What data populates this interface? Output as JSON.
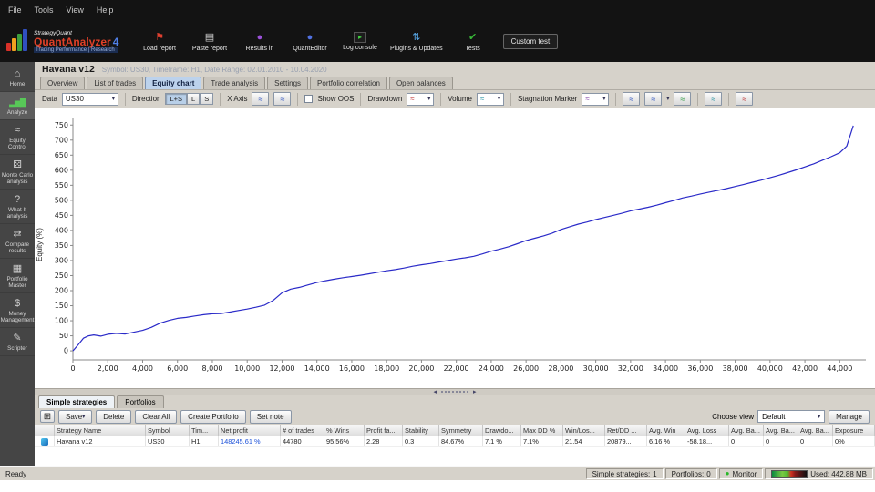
{
  "menu": {
    "items": [
      "File",
      "Tools",
      "View",
      "Help"
    ]
  },
  "brand": {
    "app": "StrategyQuant",
    "product": "QuantAnalyzer",
    "version": "4",
    "subtitle": "Trading Performance | Research"
  },
  "toolbar": {
    "buttons": [
      "Load report",
      "Paste report",
      "Results in",
      "QuantEditor",
      "Log console",
      "Plugins & Updates",
      "Tests",
      "Custom test"
    ]
  },
  "sidebar": {
    "items": [
      "Home",
      "Analyze",
      "Equity Control",
      "Monte Carlo analysis",
      "What If analysis",
      "Compare results",
      "Portfolio Master",
      "Money Management",
      "Scripter"
    ]
  },
  "report": {
    "title": "Havana v12",
    "subtitle": "Symbol: US30, Timeframe: H1, Date Range: 02.01.2010 - 10.04.2020",
    "tabs": [
      "Overview",
      "List of trades",
      "Equity chart",
      "Trade analysis",
      "Settings",
      "Portfolio correlation",
      "Open balances"
    ]
  },
  "chart_toolbar": {
    "data_label": "Data",
    "data_value": "US30",
    "direction_label": "Direction",
    "dir_ls": "L+S",
    "dir_l": "L",
    "dir_s": "S",
    "xaxis_label": "X Axis",
    "show_oos_label": "Show OOS",
    "drawdown_label": "Drawdown",
    "volume_label": "Volume",
    "stagnation_label": "Stagnation Marker"
  },
  "chart_data": {
    "type": "line",
    "title": "",
    "xlabel": "",
    "ylabel": "Equity (%)",
    "xlim": [
      0,
      45500
    ],
    "ylim": [
      -30,
      775
    ],
    "grid": false,
    "legend": "none",
    "x_ticks": [
      {
        "v": 0,
        "label": "0"
      },
      {
        "v": 2000,
        "label": "2,000"
      },
      {
        "v": 4000,
        "label": "4,000"
      },
      {
        "v": 6000,
        "label": "6,000"
      },
      {
        "v": 8000,
        "label": "8,000"
      },
      {
        "v": 10000,
        "label": "10,000"
      },
      {
        "v": 12000,
        "label": "12,000"
      },
      {
        "v": 14000,
        "label": "14,000"
      },
      {
        "v": 16000,
        "label": "16,000"
      },
      {
        "v": 18000,
        "label": "18,000"
      },
      {
        "v": 20000,
        "label": "20,000"
      },
      {
        "v": 22000,
        "label": "22,000"
      },
      {
        "v": 24000,
        "label": "24,000"
      },
      {
        "v": 26000,
        "label": "26,000"
      },
      {
        "v": 28000,
        "label": "28,000"
      },
      {
        "v": 30000,
        "label": "30,000"
      },
      {
        "v": 32000,
        "label": "32,000"
      },
      {
        "v": 34000,
        "label": "34,000"
      },
      {
        "v": 36000,
        "label": "36,000"
      },
      {
        "v": 38000,
        "label": "38,000"
      },
      {
        "v": 40000,
        "label": "40,000"
      },
      {
        "v": 42000,
        "label": "42,000"
      },
      {
        "v": 44000,
        "label": "44,000"
      }
    ],
    "y_ticks": [
      0,
      50,
      100,
      150,
      200,
      250,
      300,
      350,
      400,
      450,
      500,
      550,
      600,
      650,
      700,
      750
    ],
    "series": [
      {
        "name": "Equity",
        "color": "#2a2ac8",
        "x": [
          0,
          300,
          600,
          900,
          1200,
          1600,
          2000,
          2500,
          3000,
          3500,
          4000,
          4500,
          5000,
          5500,
          6000,
          6500,
          7000,
          7500,
          8000,
          8500,
          9000,
          9500,
          10000,
          10500,
          11000,
          11500,
          12000,
          12500,
          13000,
          13500,
          14000,
          14500,
          15000,
          15500,
          16000,
          16500,
          17000,
          17500,
          18000,
          18500,
          19000,
          19500,
          20000,
          20500,
          21000,
          21500,
          22000,
          22500,
          23000,
          23500,
          24000,
          24500,
          25000,
          25500,
          26000,
          26500,
          27000,
          27500,
          28000,
          28500,
          29000,
          29500,
          30000,
          30500,
          31000,
          31500,
          32000,
          32500,
          33000,
          33500,
          34000,
          34500,
          35000,
          35500,
          36000,
          36500,
          37000,
          37500,
          38000,
          38500,
          39000,
          39500,
          40000,
          40500,
          41000,
          41500,
          42000,
          42500,
          43000,
          43500,
          44000,
          44400,
          44780
        ],
        "y": [
          0,
          20,
          42,
          50,
          53,
          49,
          55,
          58,
          56,
          62,
          68,
          78,
          92,
          101,
          108,
          111,
          116,
          120,
          123,
          124,
          129,
          134,
          139,
          145,
          152,
          168,
          193,
          205,
          211,
          219,
          227,
          233,
          238,
          243,
          247,
          251,
          256,
          261,
          266,
          270,
          275,
          281,
          286,
          290,
          295,
          300,
          305,
          309,
          314,
          322,
          331,
          338,
          346,
          356,
          366,
          374,
          382,
          391,
          403,
          412,
          421,
          428,
          436,
          443,
          450,
          457,
          465,
          471,
          477,
          484,
          492,
          500,
          508,
          514,
          521,
          527,
          533,
          539,
          546,
          553,
          560,
          567,
          575,
          583,
          592,
          601,
          611,
          621,
          633,
          645,
          658,
          680,
          748
        ]
      }
    ]
  },
  "bottom": {
    "tabs": [
      "Simple strategies",
      "Portfolios"
    ],
    "save_label": "Save",
    "delete_label": "Delete",
    "clear_all_label": "Clear All",
    "create_portfolio_label": "Create Portfolio",
    "set_note_label": "Set note",
    "choose_view_label": "Choose view",
    "choose_view_value": "Default",
    "manage_label": "Manage",
    "table": {
      "columns": [
        "Strategy Name",
        "Symbol",
        "Tim...",
        "Net profit",
        "# of trades",
        "% Wins",
        "Profit fa...",
        "Stability",
        "Symmetry",
        "Drawdo...",
        "Max DD %",
        "Win/Los...",
        "Ret/DD ...",
        "Avg. Win",
        "Avg. Loss",
        "Avg. Ba...",
        "Avg. Ba...",
        "Avg. Ba...",
        "Exposure"
      ],
      "rows": [
        [
          "Havana v12",
          "US30",
          "H1",
          "148245.61 %",
          "44780",
          "95.56%",
          "2.28",
          "0.3",
          "84.67%",
          "7.1 %",
          "7.1%",
          "21.54",
          "20879...",
          "6.16 %",
          "-58.18...",
          "0",
          "0",
          "0",
          "0%"
        ]
      ]
    }
  },
  "statusbar": {
    "ready": "Ready",
    "simple_strategies_label": "Simple strategies:",
    "simple_strategies_value": "1",
    "portfolios_label": "Portfolios:",
    "portfolios_value": "0",
    "monitor_label": "Monitor",
    "memory_used": "Used: 442.88 MB"
  },
  "icons": {
    "caret": "▾",
    "home": "⌂",
    "analyze": "▂▅▇",
    "equity_control": "≈",
    "monte_carlo": "⚄",
    "what_if": "?",
    "compare": "⇄",
    "portfolio": "▦",
    "money": "$",
    "scripter": "✎",
    "load_report": "⚑",
    "paste_report": "▤",
    "results_in": "●",
    "quanteditor": "●",
    "log_console": "▸",
    "plugins": "⇅",
    "tests": "✔",
    "grid": "⊞",
    "mini_line": "≈",
    "left_arrow": "◂",
    "right_arrow": "▸",
    "monitor_dot": "●"
  }
}
